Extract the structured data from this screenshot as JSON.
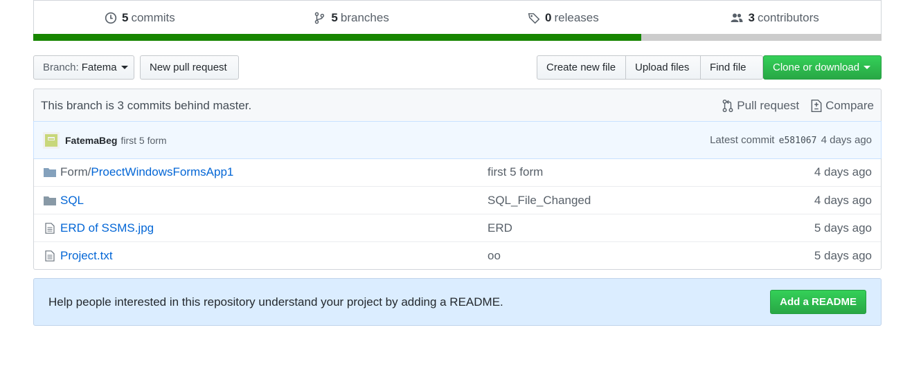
{
  "summary": {
    "commits": {
      "num": "5",
      "label": "commits",
      "icon": "history-icon"
    },
    "branches": {
      "num": "5",
      "label": "branches",
      "icon": "git-branch-icon"
    },
    "releases": {
      "num": "0",
      "label": "releases",
      "icon": "tag-icon"
    },
    "contributors": {
      "num": "3",
      "label": "contributors",
      "icon": "people-icon"
    },
    "language_bar": [
      {
        "color": "#178600",
        "fraction": 0.717
      },
      {
        "color": "#cccccc",
        "fraction": 0.283
      }
    ]
  },
  "toolbar": {
    "branch_prefix": "Branch:",
    "branch_name": "Fatema",
    "new_pull_request": "New pull request",
    "create_new_file": "Create new file",
    "upload_files": "Upload files",
    "find_file": "Find file",
    "clone_or_download": "Clone or download"
  },
  "branch_info": {
    "message": "This branch is 3 commits behind master.",
    "pull_request": "Pull request",
    "compare": "Compare"
  },
  "commit": {
    "author": "FatemaBeg",
    "message": "first 5 form",
    "latest_label": "Latest commit",
    "sha": "e581067",
    "age": "4 days ago"
  },
  "files": [
    {
      "type": "dir",
      "prefix": "Form/",
      "name": "ProectWindowsFormsApp1",
      "message": "first 5 form",
      "age": "4 days ago"
    },
    {
      "type": "dir",
      "prefix": "",
      "name": "SQL",
      "message": "SQL_File_Changed",
      "age": "4 days ago"
    },
    {
      "type": "file",
      "prefix": "",
      "name": "ERD of SSMS.jpg",
      "message": "ERD",
      "age": "5 days ago"
    },
    {
      "type": "file",
      "prefix": "",
      "name": "Project.txt",
      "message": "oo",
      "age": "5 days ago"
    }
  ],
  "readme": {
    "message": "Help people interested in this repository understand your project by adding a README.",
    "button": "Add a README"
  },
  "colors": {
    "green_button": "#28a745",
    "link": "#0366d6",
    "banner_bg": "#dbedff"
  }
}
